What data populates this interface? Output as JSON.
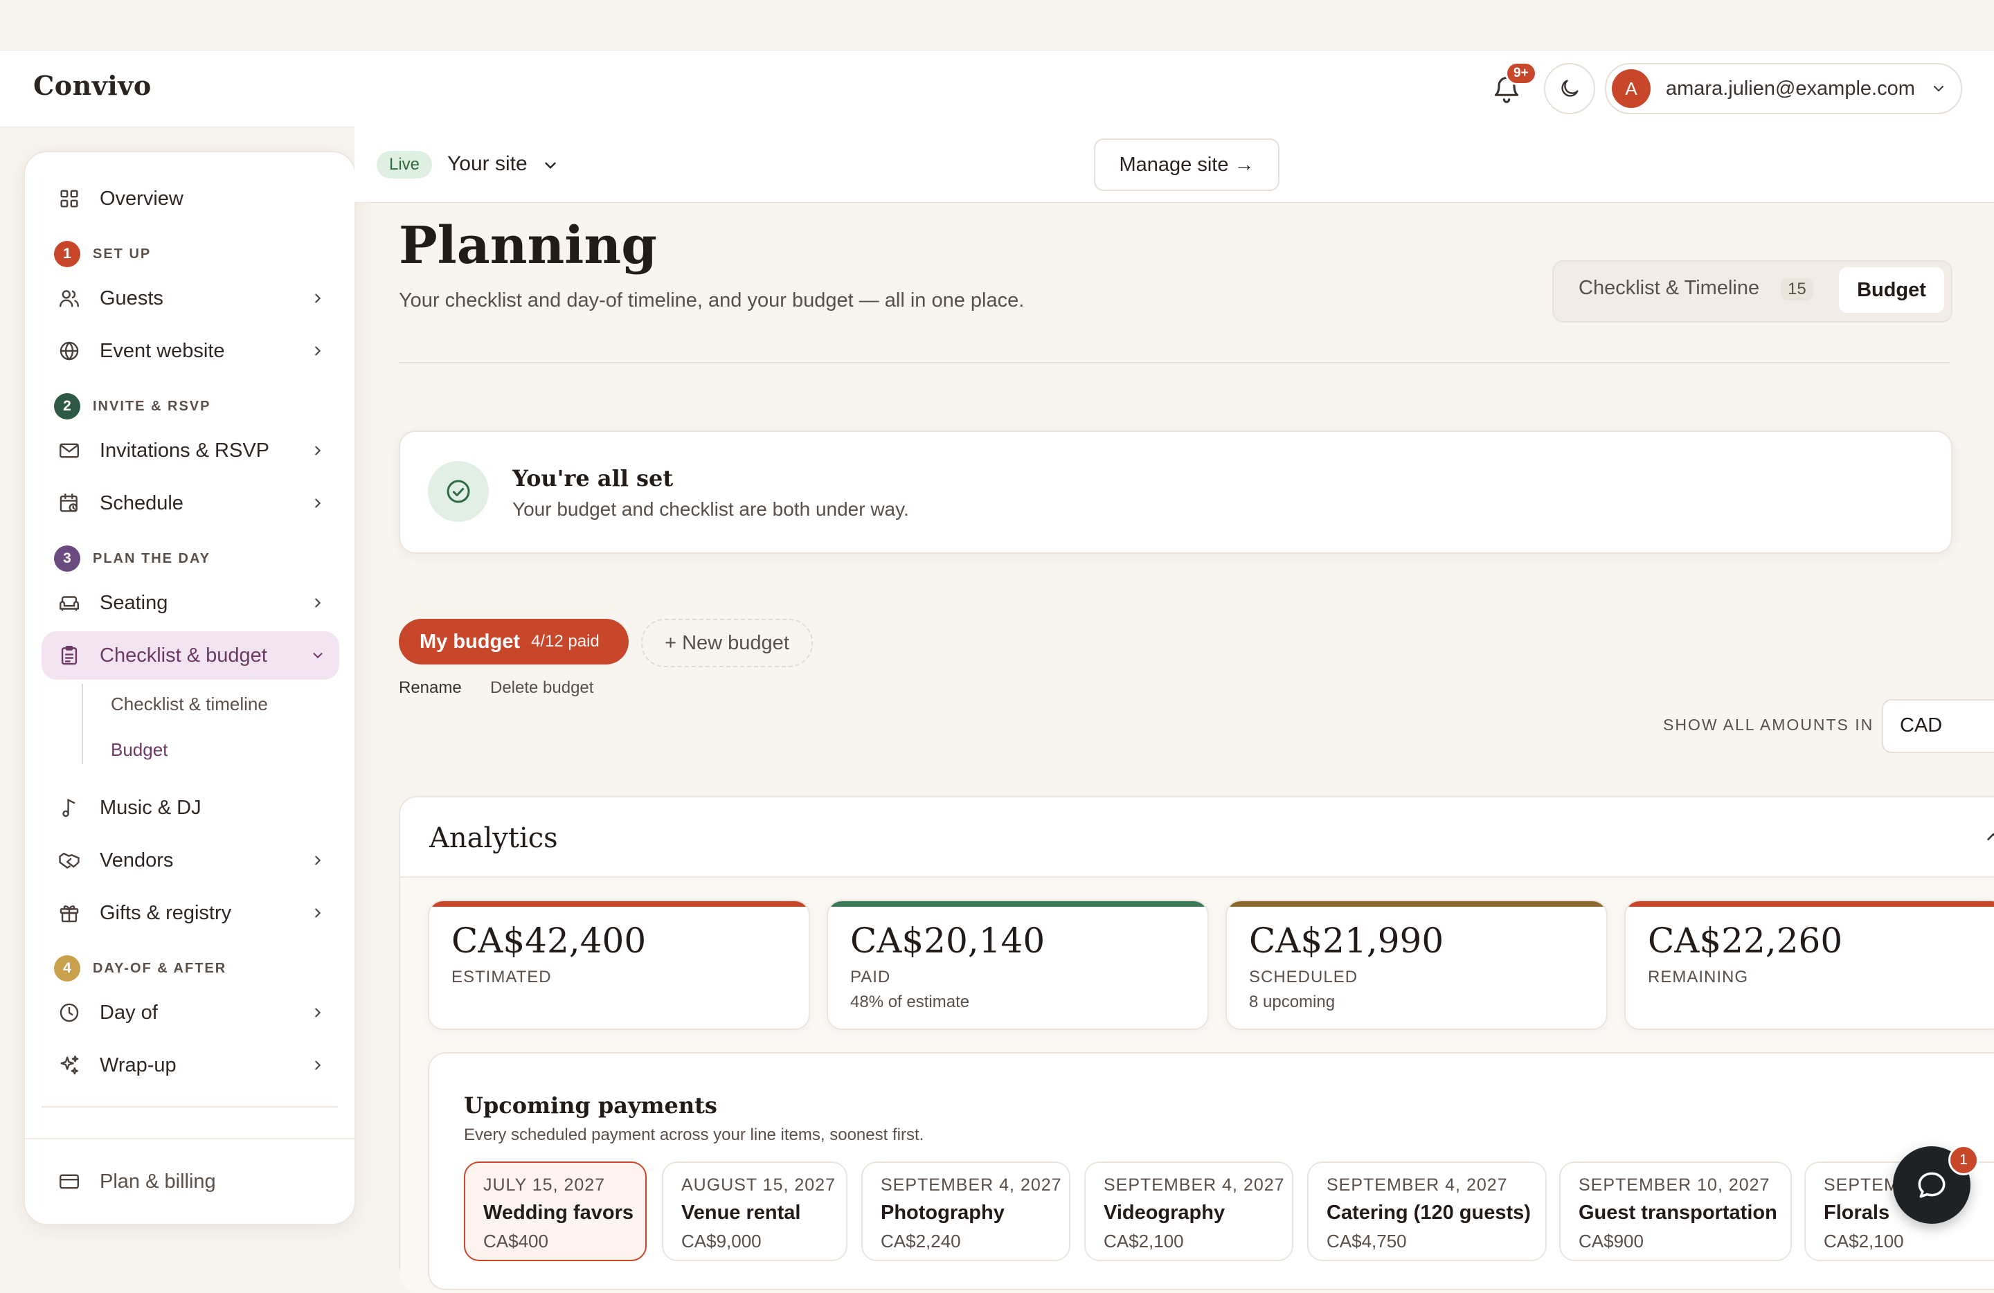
{
  "app": {
    "brand": "Convivo"
  },
  "header": {
    "notifications_badge": "9+",
    "account_initial": "A",
    "account_email": "amara.julien@example.com"
  },
  "sidebar": {
    "overview": "Overview",
    "sections": [
      {
        "num": "1",
        "title": "SET UP",
        "color": "#c8472b"
      },
      {
        "num": "2",
        "title": "INVITE & RSVP",
        "color": "#2e5a45"
      },
      {
        "num": "3",
        "title": "PLAN THE DAY",
        "color": "#6b4a80"
      },
      {
        "num": "4",
        "title": "DAY-OF & AFTER",
        "color": "#c9a04b"
      }
    ],
    "items": {
      "guests": "Guests",
      "event_website": "Event website",
      "invitations": "Invitations & RSVP",
      "schedule": "Schedule",
      "seating": "Seating",
      "checklist_budget": "Checklist & budget",
      "music": "Music & DJ",
      "vendors": "Vendors",
      "gifts": "Gifts & registry",
      "day_of": "Day of",
      "wrap_up": "Wrap-up"
    },
    "sub_items": {
      "checklist_timeline": "Checklist & timeline",
      "budget": "Budget"
    },
    "billing": "Plan & billing"
  },
  "sitebar": {
    "status": "Live",
    "site_name": "Your site",
    "manage": "Manage site →"
  },
  "page": {
    "title": "Planning",
    "subtitle": "Your checklist and day-of timeline, and your budget — all in one place.",
    "tabs": {
      "checklist": "Checklist & Timeline",
      "checklist_count": "15",
      "budget": "Budget"
    }
  },
  "all_set": {
    "title": "You're all set",
    "text": "Your budget and checklist are both under way."
  },
  "budgets": {
    "current": "My budget",
    "current_paid": "4/12 paid",
    "new": "+ New budget",
    "rename": "Rename",
    "delete": "Delete budget",
    "amounts_label": "SHOW ALL AMOUNTS IN",
    "currency": "CAD"
  },
  "analytics": {
    "title": "Analytics",
    "stats": [
      {
        "value": "CA$42,400",
        "label": "ESTIMATED",
        "note": "",
        "color": "#c8472b"
      },
      {
        "value": "CA$20,140",
        "label": "PAID",
        "note": "48% of estimate",
        "color": "#3b7a57"
      },
      {
        "value": "CA$21,990",
        "label": "SCHEDULED",
        "note": "8 upcoming",
        "color": "#8a6a2e"
      },
      {
        "value": "CA$22,260",
        "label": "REMAINING",
        "note": "",
        "color": "#c8472b"
      }
    ],
    "upcoming": {
      "title": "Upcoming payments",
      "subtitle": "Every scheduled payment across your line items, soonest first.",
      "payments": [
        {
          "date": "JULY 15, 2027",
          "name": "Wedding favors",
          "amount": "CA$400"
        },
        {
          "date": "AUGUST 15, 2027",
          "name": "Venue rental",
          "amount": "CA$9,000"
        },
        {
          "date": "SEPTEMBER 4, 2027",
          "name": "Photography",
          "amount": "CA$2,240"
        },
        {
          "date": "SEPTEMBER 4, 2027",
          "name": "Videography",
          "amount": "CA$2,100"
        },
        {
          "date": "SEPTEMBER 4, 2027",
          "name": "Catering (120 guests)",
          "amount": "CA$4,750"
        },
        {
          "date": "SEPTEMBER 10, 2027",
          "name": "Guest transportation",
          "amount": "CA$900"
        },
        {
          "date": "SEPTEMBER",
          "name": "Florals",
          "amount": "CA$2,100"
        }
      ]
    }
  },
  "chat": {
    "badge": "1"
  }
}
